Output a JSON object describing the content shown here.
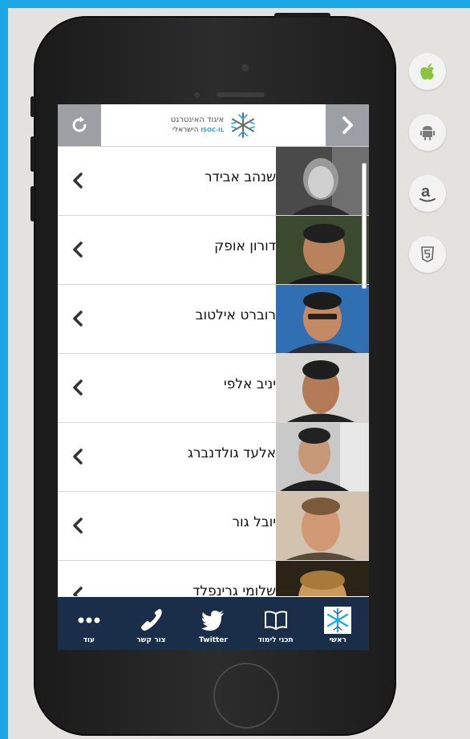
{
  "header": {
    "logo_line1": "איגוד האינטרנט",
    "logo_line2": "הישראלי",
    "logo_badge": "ISOC-IL"
  },
  "speakers": [
    {
      "name": "שנהב אבידר",
      "photo": "person-1"
    },
    {
      "name": "דורון אופק",
      "photo": "person-2"
    },
    {
      "name": "רוברט אילטוב",
      "photo": "person-3"
    },
    {
      "name": "יניב אלפי",
      "photo": "person-4"
    },
    {
      "name": "אלעד גולדנברג",
      "photo": "person-5"
    },
    {
      "name": "יובל גור",
      "photo": "person-6"
    },
    {
      "name": "שלומי גרינפלד",
      "photo": "person-7"
    }
  ],
  "tabs": [
    {
      "label": "ראשי",
      "icon": "isoc-logo-icon"
    },
    {
      "label": "תכני לימוד",
      "icon": "book-icon"
    },
    {
      "label": "Twitter",
      "icon": "twitter-bird-icon"
    },
    {
      "label": "צור קשר",
      "icon": "phone-icon"
    },
    {
      "label": "עוד",
      "icon": "more-dots-icon"
    }
  ],
  "stores": [
    {
      "name": "apple-store",
      "icon": "apple-icon",
      "color": "#8cc43f"
    },
    {
      "name": "android-store",
      "icon": "android-icon",
      "color": "#7a7a7a"
    },
    {
      "name": "amazon-store",
      "icon": "amazon-icon",
      "color": "#555555"
    },
    {
      "name": "html5-store",
      "icon": "html5-icon",
      "color": "#666666"
    }
  ],
  "colors": {
    "background": "#1aa7e6",
    "panel": "#e4e2df",
    "tabbar": "#1a2e4a",
    "topbar_buttons": "#9c9fa3",
    "accent": "#1aa7e6"
  }
}
